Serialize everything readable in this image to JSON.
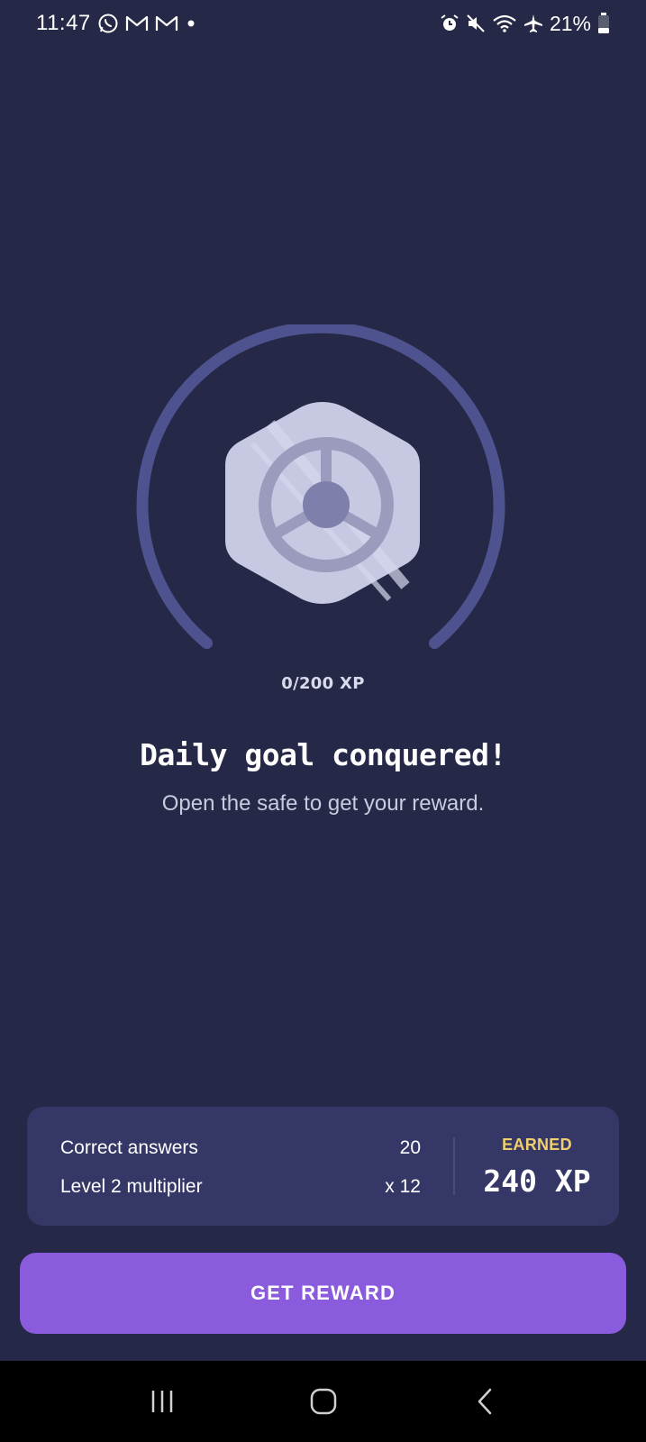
{
  "status_bar": {
    "time": "11:47",
    "left_icons": [
      "whatsapp-icon",
      "gmail-icon",
      "gmail-icon",
      "dot-icon"
    ],
    "right_icons": [
      "alarm-icon",
      "mute-icon",
      "wifi-icon",
      "airplane-icon",
      "battery-icon"
    ],
    "battery_percent": "21%"
  },
  "goal": {
    "progress_text": "0/200 XP",
    "progress_fraction": 0,
    "headline": "Daily goal conquered!",
    "subtitle": "Open the safe to get your reward."
  },
  "summary": {
    "rows": [
      {
        "label": "Correct answers",
        "value": "20"
      },
      {
        "label": "Level 2 multiplier",
        "value": "x 12"
      }
    ],
    "earned_label": "EARNED",
    "earned_value": "240 XP"
  },
  "cta": {
    "label": "GET REWARD"
  },
  "nav": {
    "buttons": [
      "recents-icon",
      "home-icon",
      "back-icon"
    ]
  },
  "colors": {
    "background": "#252846",
    "ring": "#4e528e",
    "card": "#353866",
    "accent_button": "#8a5bdc",
    "earned_label": "#f2cf6e",
    "safe": "#c7c8e2"
  }
}
